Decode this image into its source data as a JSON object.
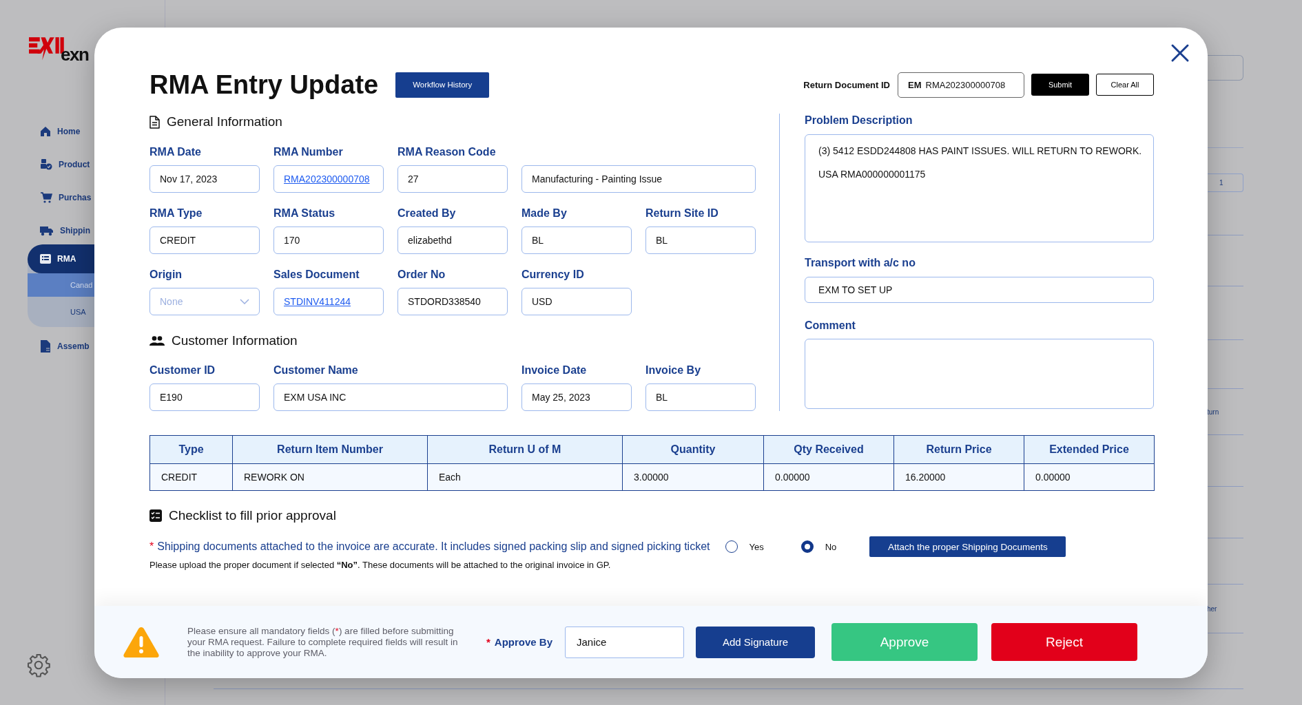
{
  "sidebar": {
    "brand": "exn",
    "items": [
      {
        "label": "Home",
        "selected": false
      },
      {
        "label": "Product",
        "selected": false
      },
      {
        "label": "Purchas",
        "selected": false
      },
      {
        "label": "Shippin",
        "selected": false
      },
      {
        "label": "RMA",
        "selected": true,
        "expanded": true,
        "children": [
          {
            "label": "Canad",
            "selected": true
          },
          {
            "label": "USA",
            "selected": false
          }
        ]
      },
      {
        "label": "Assemb",
        "selected": false
      }
    ]
  },
  "background": {
    "page_number": "1",
    "row_texts": [
      "turn",
      "her"
    ]
  },
  "dialog": {
    "title": "RMA Entry Update",
    "workflow_button": "Workflow History",
    "return_document": {
      "label": "Return Document ID",
      "prefix": "EM",
      "value": "RMA202300000708"
    },
    "header_buttons": [
      {
        "label": "Submit",
        "kind": "primary"
      },
      {
        "label": "Clear All",
        "kind": "outline"
      }
    ],
    "general": {
      "title": "General Information",
      "fields": [
        {
          "label": "RMA Date",
          "value": "Nov 17, 2023",
          "kind": "text"
        },
        {
          "label": "RMA Number",
          "value": "RMA202300000708",
          "kind": "link"
        },
        {
          "label": "RMA Reason Code",
          "value": "27",
          "kind": "text"
        },
        {
          "value": "Manufacturing - Painting Issue",
          "kind": "wide"
        },
        {
          "label": "RMA Type",
          "value": "CREDIT",
          "kind": "text"
        },
        {
          "label": "RMA Status",
          "value": "170",
          "kind": "text"
        },
        {
          "label": "Created By",
          "value": "elizabethd",
          "kind": "text"
        },
        {
          "label": "Made By",
          "value": "BL",
          "kind": "text"
        },
        {
          "label": "Return Site ID",
          "value": "BL",
          "kind": "text"
        },
        {
          "label": "Origin",
          "placeholder": "None",
          "kind": "select"
        },
        {
          "label": "Sales Document",
          "value": "STDINV411244",
          "kind": "link"
        },
        {
          "label": "Order No",
          "value": "STDORD338540",
          "kind": "text"
        },
        {
          "label": "Currency ID",
          "value": "USD",
          "kind": "text"
        }
      ]
    },
    "customer": {
      "title": "Customer Information",
      "fields": [
        {
          "label": "Customer ID",
          "value": "E190",
          "kind": "text"
        },
        {
          "label": "Customer Name",
          "value": "EXM USA INC",
          "kind": "wide"
        },
        {
          "label": "Invoice Date",
          "value": "May 25, 2023",
          "kind": "text"
        },
        {
          "label": "Invoice By",
          "value": "BL",
          "kind": "text"
        }
      ]
    },
    "problem_description": {
      "label": "Problem Description",
      "lines": [
        "(3) 5412 ESDD244808 HAS PAINT ISSUES. WILL RETURN TO REWORK.",
        "USA RMA000000001175"
      ]
    },
    "transport": {
      "label": "Transport with a/c no",
      "value": "EXM TO SET UP"
    },
    "comment": {
      "label": "Comment"
    },
    "table": {
      "columns": [
        "Type",
        "Return Item Number",
        "Return U of M",
        "Quantity",
        "Qty Received",
        "Return Price",
        "Extended Price"
      ],
      "rows": [
        [
          "CREDIT",
          "REWORK ON",
          "Each",
          "3.00000",
          "0.00000",
          "16.20000",
          "0.00000"
        ]
      ]
    },
    "checklist": {
      "title": "Checklist to fill prior approval",
      "items": [
        {
          "mark": "*",
          "text": "Shipping documents attached to the invoice are accurate. It includes signed packing slip and signed picking ticket",
          "options": [
            {
              "label": "Yes",
              "selected": false
            },
            {
              "label": "No",
              "selected": true
            }
          ],
          "button": "Attach the proper Shipping Documents"
        }
      ],
      "note": "Please upload the proper document if selected **“No”**. These documents will be attached to the original invoice in GP."
    },
    "footer": {
      "warning": {
        "before": "Please ensure all mandatory fields (",
        "mark": "*",
        "after": ") are filled before submitting your RMA request. Failure to complete required fields will result in the inability to approve your RMA."
      },
      "approver": {
        "mark": "*",
        "label": "Approve By",
        "value": "Janice"
      },
      "buttons": [
        {
          "label": "Add Signature",
          "kind": "signature"
        },
        {
          "label": "Approve",
          "kind": "approve"
        },
        {
          "label": "Reject",
          "kind": "reject"
        }
      ]
    }
  }
}
